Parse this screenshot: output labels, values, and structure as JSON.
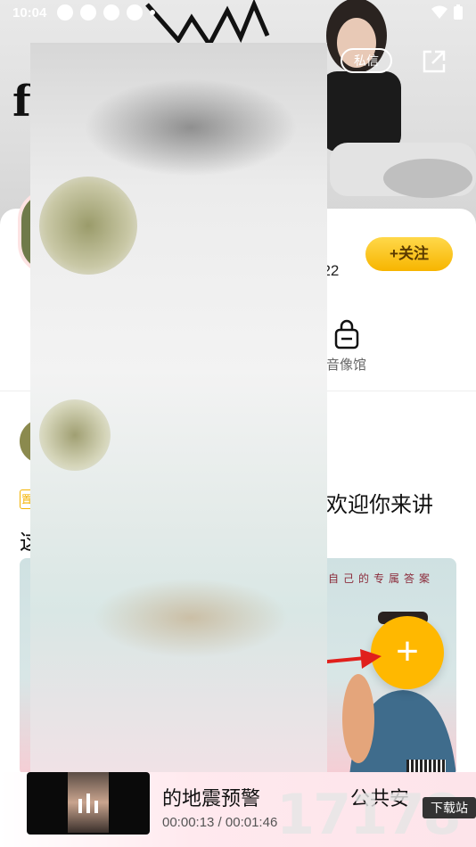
{
  "status_bar": {
    "time": "10:04"
  },
  "header": {
    "message_label": "私信",
    "cover_char": "f"
  },
  "profile": {
    "follow_label": "+关注",
    "fans_count": "522",
    "library_label": "音像馆"
  },
  "post": {
    "tag": "置",
    "text_right": "欢迎你来讲",
    "text_left": "这",
    "image_caption": "自己的专属答案"
  },
  "player": {
    "title": "的地震预警",
    "title_right": "公共安",
    "time": "00:00:13 / 00:01:46"
  },
  "watermark": {
    "number": "17178",
    "site": "下载站"
  },
  "colors": {
    "accent": "#ffb800",
    "follow_bg": "#f7b500",
    "arrow": "#e0201c"
  }
}
